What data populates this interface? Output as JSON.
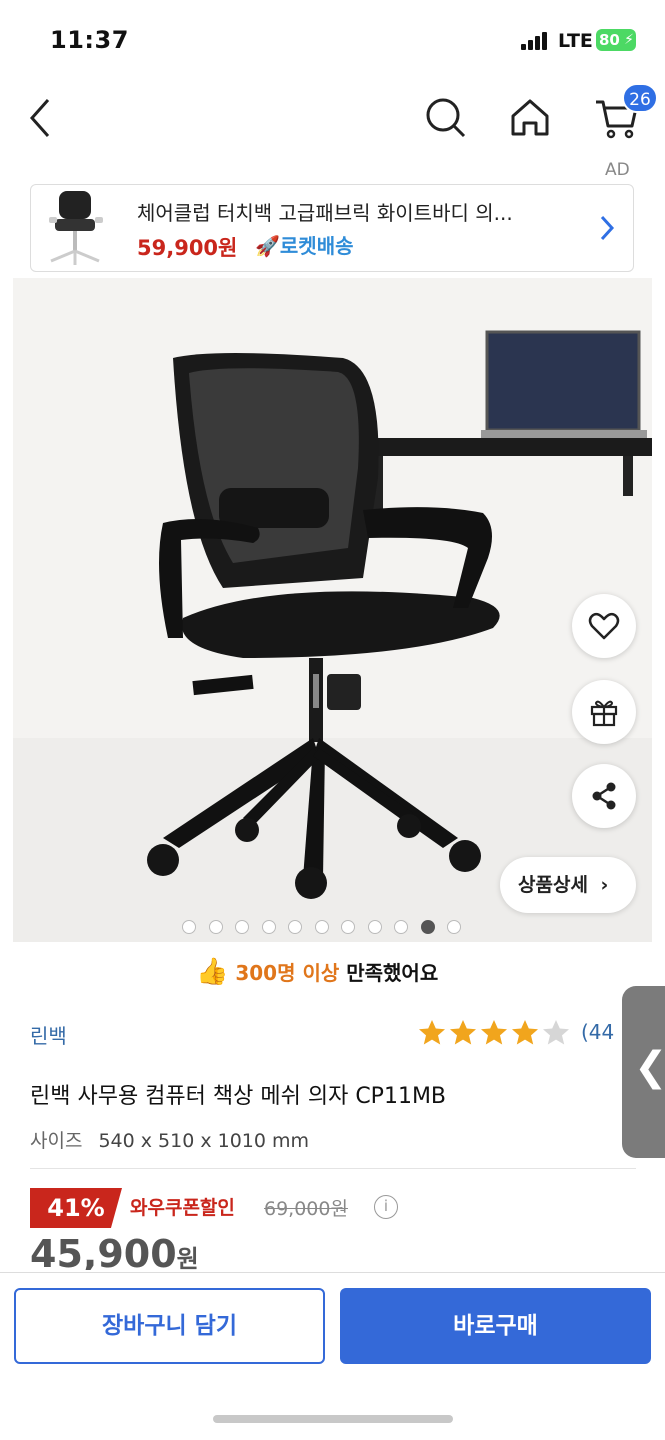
{
  "status_bar": {
    "time": "11:37",
    "network": "LTE",
    "battery": "80"
  },
  "nav": {
    "cart_count": "26",
    "ad_label": "AD"
  },
  "ad_banner": {
    "title": "체어클럽 터치백 고급패브릭 화이트바디 의...",
    "price": "59,900원",
    "delivery": "로켓배송"
  },
  "gallery": {
    "detail_button": "상품상세",
    "dot_count": 11,
    "active_dot": 9
  },
  "satisfaction": {
    "highlight": "300명 이상",
    "text": "만족했어요"
  },
  "product": {
    "brand": "린백",
    "rating_stars": 4,
    "rating_count": "(44",
    "title": "린백 사무용 컴퓨터 책상 메쉬 의자 CP11MB",
    "size_label": "사이즈",
    "size_value": "540 x 510 x 1010 mm"
  },
  "pricing": {
    "discount": "41%",
    "coupon_label": "와우쿠폰할인",
    "original_price": "69,000원",
    "info": "i",
    "sale_price": "45,900",
    "sale_unit": "원"
  },
  "actions": {
    "add_to_cart": "장바구니 담기",
    "buy_now": "바로구매"
  },
  "colors": {
    "accent_blue": "#3469d8",
    "sale_red": "#c9261c",
    "satisfaction_orange": "#e0761b",
    "star_gold": "#f1a51d"
  }
}
